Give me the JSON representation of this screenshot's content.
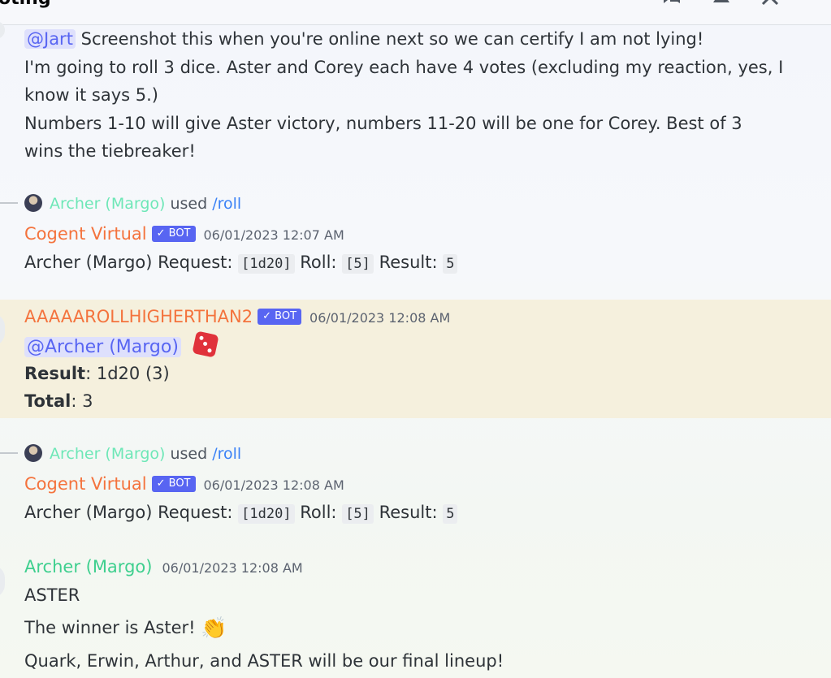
{
  "header": {
    "channel_name": "oting"
  },
  "messages": {
    "m1": {
      "mention": "@Jart",
      "line1": " Screenshot this when you're online next so we can certify I am not lying!",
      "line2": "I'm going to roll 3 dice. Aster and Corey each have 4 votes (excluding my reaction, yes, I",
      "line3": "know it says 5.)",
      "line4": "Numbers 1-10 will give Aster victory, numbers 11-20 will be one for Corey. Best of 3",
      "line5": "wins the tiebreaker!"
    },
    "m2": {
      "reply_user": "Archer (Margo)",
      "reply_used": " used ",
      "reply_command": "/roll",
      "author": "Cogent Virtual",
      "bot_tag": "✓ BOT",
      "timestamp": "06/01/2023 12:07 AM",
      "req_label": "Archer (Margo) Request: ",
      "req_code": "[1d20]",
      "roll_label": " Roll: ",
      "roll_code": "[5]",
      "result_label": " Result: ",
      "result_code": "5"
    },
    "m3": {
      "author": "AAAAAROLLHIGHERTHAN2",
      "bot_tag": "✓ BOT",
      "timestamp": "06/01/2023 12:08 AM",
      "mention": "@Archer (Margo)",
      "result_label": "Result",
      "result_value": ": 1d20 (3)",
      "total_label": "Total",
      "total_value": ": 3"
    },
    "m4": {
      "reply_user": "Archer (Margo)",
      "reply_used": " used ",
      "reply_command": "/roll",
      "author": "Cogent Virtual",
      "bot_tag": "✓ BOT",
      "timestamp": "06/01/2023 12:08 AM",
      "req_label": "Archer (Margo) Request: ",
      "req_code": "[1d20]",
      "roll_label": " Roll: ",
      "roll_code": "[5]",
      "result_label": " Result: ",
      "result_code": "5"
    },
    "m5": {
      "author": "Archer (Margo)",
      "timestamp": "06/01/2023 12:08 AM",
      "line1": "ASTER",
      "line2": "The winner is Aster! ",
      "clap": "👏",
      "line3": "Quark, Erwin, Arthur, and ASTER will be our final lineup!"
    }
  },
  "colors": {
    "bot_author": "#f4733d",
    "user_author": "#3ecf8e",
    "mention_bg": "#dee0fc",
    "highlight_bg": "#f5f0dd",
    "bot_tag": "#5865f2"
  }
}
